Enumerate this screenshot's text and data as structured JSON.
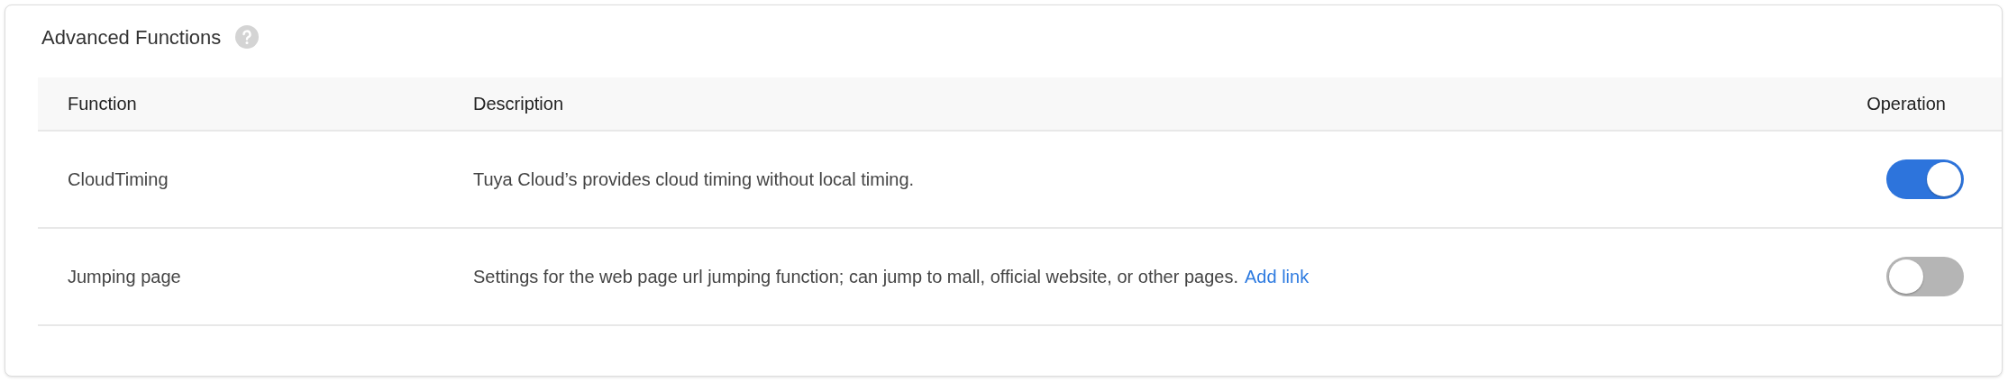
{
  "title": "Advanced Functions",
  "table": {
    "columns": [
      "Function",
      "Description",
      "Operation"
    ],
    "rows": [
      {
        "function": "CloudTiming",
        "description": "Tuya Cloud’s provides cloud timing without local timing.",
        "on": true
      },
      {
        "function": "Jumping page",
        "description": "Settings for the web page url jumping function; can jump to mall, official website, or other pages.",
        "link": "Add link",
        "on": false
      }
    ]
  }
}
